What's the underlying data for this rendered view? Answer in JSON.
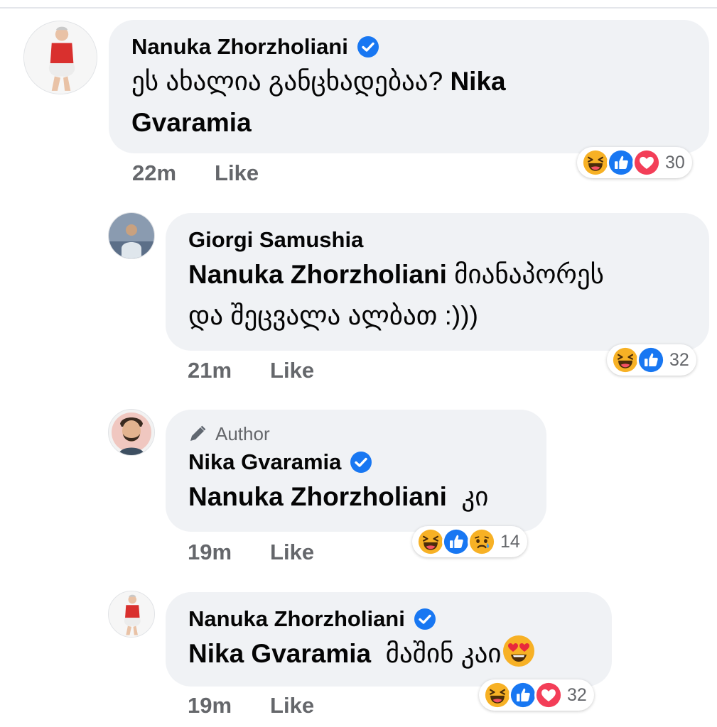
{
  "comments": [
    {
      "author": "Nanuka Zhorzholiani",
      "verified": true,
      "text": "ეს ახალია განცხადებაა?",
      "mention": "Nika",
      "text2_mention": "Gvaramia",
      "time": "22m",
      "like_label": "Like",
      "reactions": [
        "haha-icon",
        "like-icon",
        "love-icon"
      ],
      "reaction_count": "30"
    },
    {
      "author": "Giorgi Samushia",
      "verified": false,
      "mention": "Nanuka Zhorzholiani",
      "text": "მიანაპორეს",
      "text2": "და შეცვალა ალბათ :)))",
      "time": "21m",
      "like_label": "Like",
      "reactions": [
        "haha-icon",
        "like-icon"
      ],
      "reaction_count": "32"
    },
    {
      "author_tag": "Author",
      "author": "Nika Gvaramia",
      "verified": true,
      "mention": "Nanuka Zhorzholiani",
      "text": "კი",
      "time": "19m",
      "like_label": "Like",
      "reactions": [
        "haha-icon",
        "like-icon",
        "sad-icon"
      ],
      "reaction_count": "14"
    },
    {
      "author": "Nanuka Zhorzholiani",
      "verified": true,
      "mention": "Nika Gvaramia",
      "text": "მაშინ კაი",
      "inline_emoji": "heart-eyes-emoji",
      "time": "19m",
      "like_label": "Like",
      "reactions": [
        "haha-icon",
        "like-icon",
        "love-icon"
      ],
      "reaction_count": "32"
    }
  ],
  "colors": {
    "bubble": "#f0f2f5",
    "meta_text": "#65676b",
    "verified_blue": "#1877f2",
    "love_red": "#f33e58",
    "haha_yellow": "#f7b125"
  }
}
